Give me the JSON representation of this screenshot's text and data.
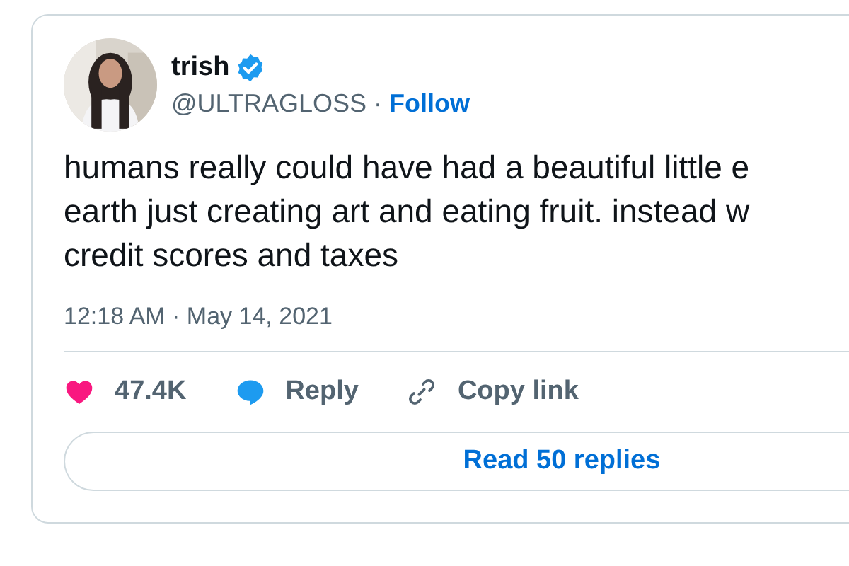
{
  "author": {
    "name": "trish",
    "verified": true,
    "handle": "@ULTRAGLOSS",
    "separator": "·",
    "follow": "Follow"
  },
  "body_lines": [
    "humans really could have had a beautiful little e",
    "earth just creating art and eating fruit. instead w",
    "credit scores and taxes"
  ],
  "timestamp": "12:18 AM · May 14, 2021",
  "actions": [
    {
      "kind": "like",
      "label": "47.4K"
    },
    {
      "kind": "reply",
      "label": "Reply"
    },
    {
      "kind": "copy",
      "label": "Copy link"
    }
  ],
  "read_replies": "Read 50 replies"
}
